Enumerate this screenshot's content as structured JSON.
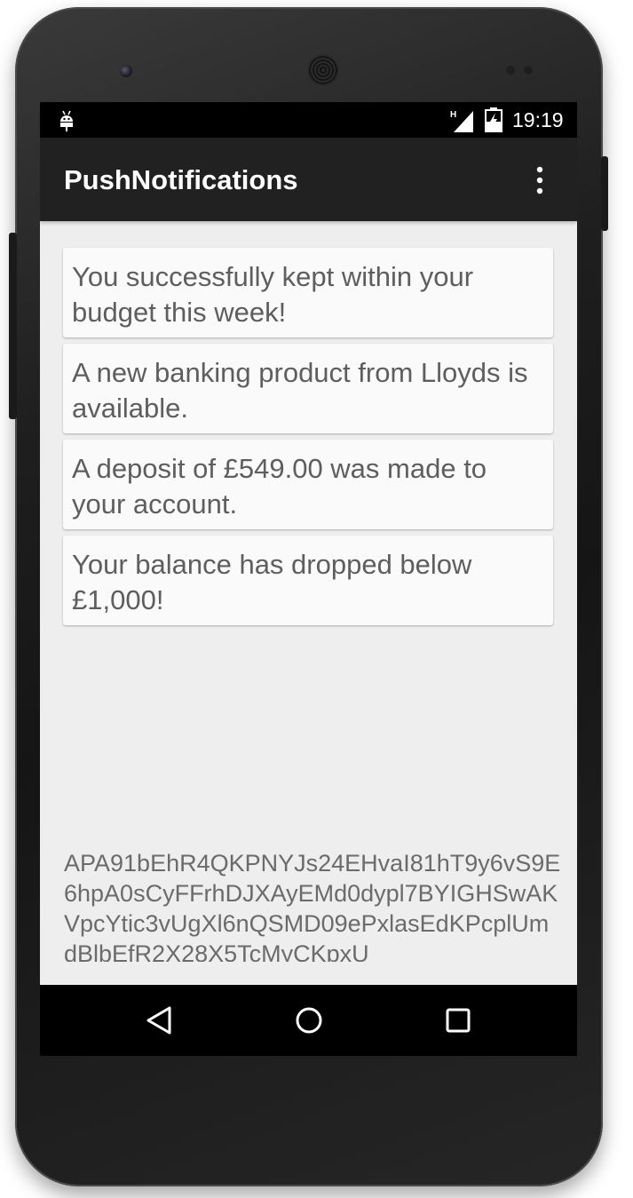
{
  "status_bar": {
    "time": "19:19",
    "icons": [
      "android-debug-icon",
      "signal-icon",
      "battery-icon"
    ],
    "network_label": "H"
  },
  "app_bar": {
    "title": "PushNotifications",
    "overflow_icon": "more-vert-icon"
  },
  "notifications": [
    "You successfully kept within your budget this week!",
    "A new banking product from Lloyds is available.",
    "A deposit of £549.00 was made to your account.",
    "Your balance has dropped below £1,000!"
  ],
  "registration_token": "APA91bEhR4QKPNYJs24EHvaI81hT9y6vS9E6hpA0sCyFFrhDJXAyEMd0dypl7BYIGHSwAKVpcYtic3vUgXl6nQSMD09ePxlasEdKPcplUmdBlbEfR2X28X5TcMyCKpxU",
  "nav_bar": {
    "back_icon": "back-icon",
    "home_icon": "home-icon",
    "recents_icon": "recents-icon"
  },
  "colors": {
    "status_bar": "#000000",
    "app_bar": "#212121",
    "background": "#eeeeee",
    "card": "#fafafa",
    "text": "#5e5e5e"
  }
}
